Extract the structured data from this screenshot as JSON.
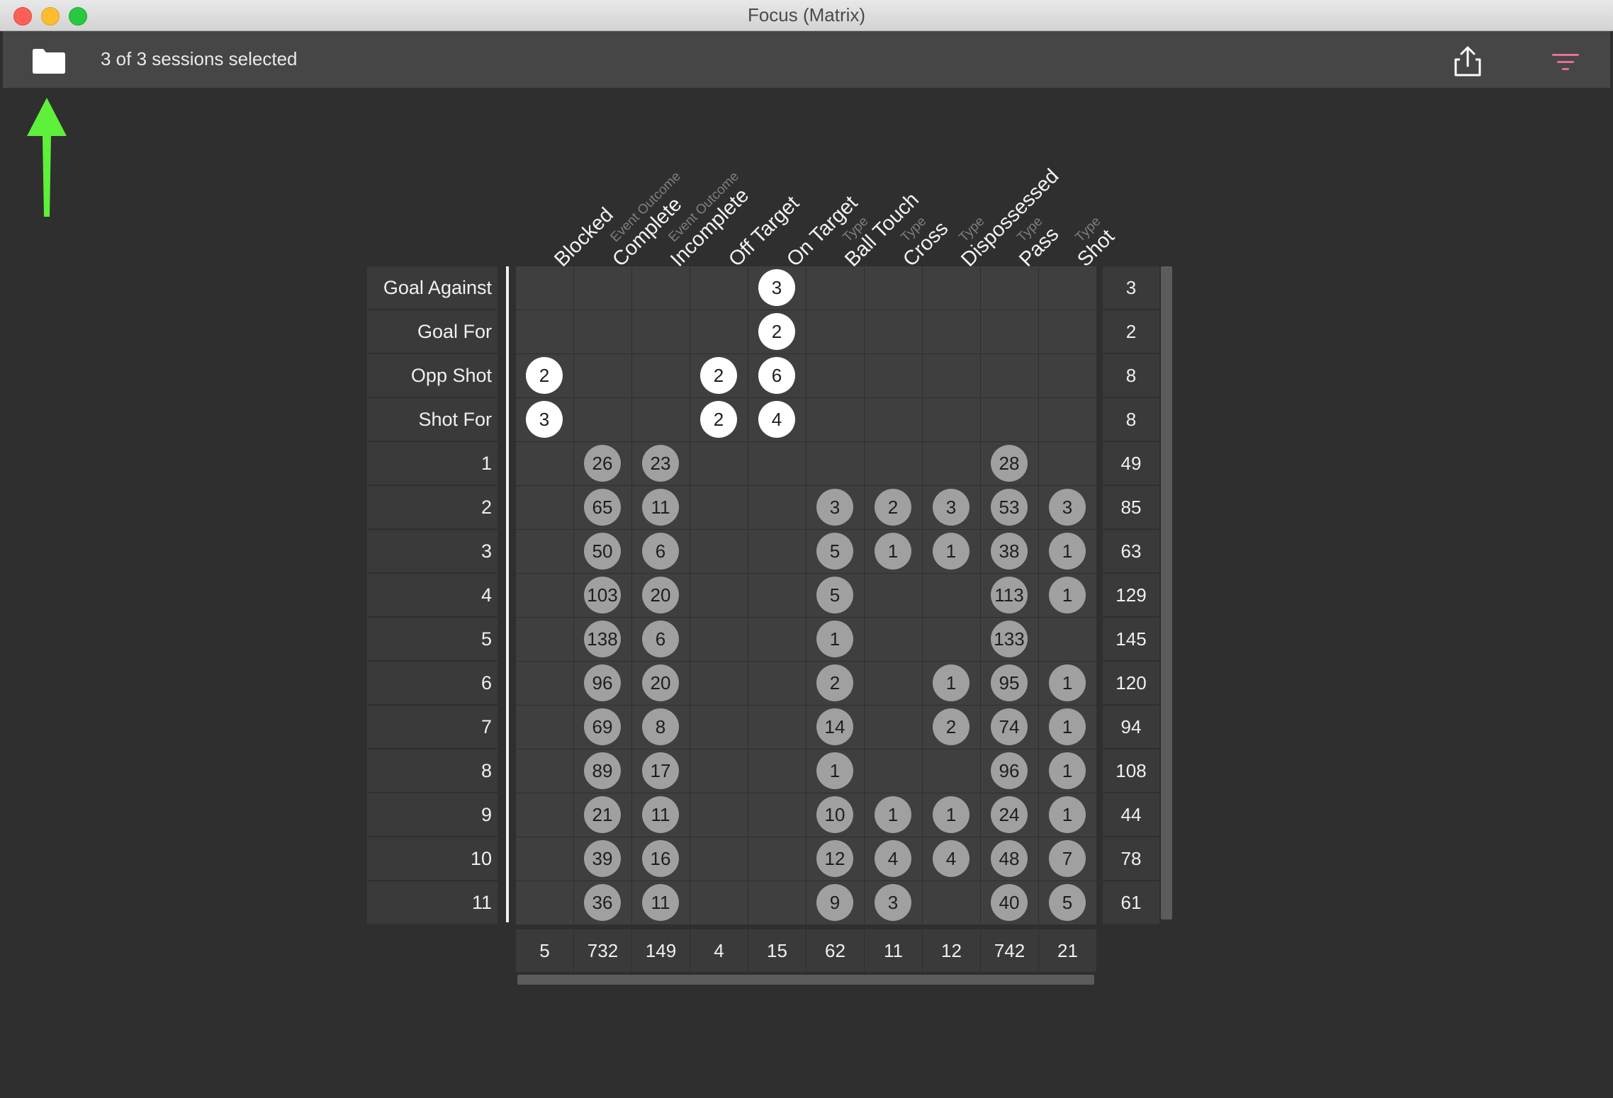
{
  "window": {
    "title": "Focus (Matrix)"
  },
  "toolbar": {
    "sessions_label": "3 of 3 sessions selected"
  },
  "columns": [
    {
      "label": "Blocked",
      "sub": ""
    },
    {
      "label": "Complete",
      "sub": "Event Outcome"
    },
    {
      "label": "Incomplete",
      "sub": "Event Outcome"
    },
    {
      "label": "Off Target",
      "sub": ""
    },
    {
      "label": "On Target",
      "sub": ""
    },
    {
      "label": "Ball Touch",
      "sub": "Type"
    },
    {
      "label": "Cross",
      "sub": "Type"
    },
    {
      "label": "Dispossessed",
      "sub": "Type"
    },
    {
      "label": "Pass",
      "sub": "Type"
    },
    {
      "label": "Shot",
      "sub": "Type"
    }
  ],
  "rows": [
    {
      "label": "Goal Against",
      "style": "white",
      "values": [
        null,
        null,
        null,
        null,
        "3",
        null,
        null,
        null,
        null,
        null
      ],
      "total": "3"
    },
    {
      "label": "Goal For",
      "style": "white",
      "values": [
        null,
        null,
        null,
        null,
        "2",
        null,
        null,
        null,
        null,
        null
      ],
      "total": "2"
    },
    {
      "label": "Opp Shot",
      "style": "white",
      "values": [
        "2",
        null,
        null,
        "2",
        "6",
        null,
        null,
        null,
        null,
        null
      ],
      "total": "8"
    },
    {
      "label": "Shot For",
      "style": "white",
      "values": [
        "3",
        null,
        null,
        "2",
        "4",
        null,
        null,
        null,
        null,
        null
      ],
      "total": "8"
    },
    {
      "label": "1",
      "style": "gray",
      "values": [
        null,
        "26",
        "23",
        null,
        null,
        null,
        null,
        null,
        "28",
        null
      ],
      "total": "49"
    },
    {
      "label": "2",
      "style": "gray",
      "values": [
        null,
        "65",
        "11",
        null,
        null,
        "3",
        "2",
        "3",
        "53",
        "3"
      ],
      "total": "85"
    },
    {
      "label": "3",
      "style": "gray",
      "values": [
        null,
        "50",
        "6",
        null,
        null,
        "5",
        "1",
        "1",
        "38",
        "1"
      ],
      "total": "63"
    },
    {
      "label": "4",
      "style": "gray",
      "values": [
        null,
        "103",
        "20",
        null,
        null,
        "5",
        null,
        null,
        "113",
        "1"
      ],
      "total": "129"
    },
    {
      "label": "5",
      "style": "gray",
      "values": [
        null,
        "138",
        "6",
        null,
        null,
        "1",
        null,
        null,
        "133",
        null
      ],
      "total": "145"
    },
    {
      "label": "6",
      "style": "gray",
      "values": [
        null,
        "96",
        "20",
        null,
        null,
        "2",
        null,
        "1",
        "95",
        "1"
      ],
      "total": "120"
    },
    {
      "label": "7",
      "style": "gray",
      "values": [
        null,
        "69",
        "8",
        null,
        null,
        "14",
        null,
        "2",
        "74",
        "1"
      ],
      "total": "94"
    },
    {
      "label": "8",
      "style": "gray",
      "values": [
        null,
        "89",
        "17",
        null,
        null,
        "1",
        null,
        null,
        "96",
        "1"
      ],
      "total": "108"
    },
    {
      "label": "9",
      "style": "gray",
      "values": [
        null,
        "21",
        "11",
        null,
        null,
        "10",
        "1",
        "1",
        "24",
        "1"
      ],
      "total": "44"
    },
    {
      "label": "10",
      "style": "gray",
      "values": [
        null,
        "39",
        "16",
        null,
        null,
        "12",
        "4",
        "4",
        "48",
        "7"
      ],
      "total": "78"
    },
    {
      "label": "11",
      "style": "gray",
      "values": [
        null,
        "36",
        "11",
        null,
        null,
        "9",
        "3",
        null,
        "40",
        "5"
      ],
      "total": "61"
    }
  ],
  "column_totals": [
    "5",
    "732",
    "149",
    "4",
    "15",
    "62",
    "11",
    "12",
    "742",
    "21"
  ],
  "colors": {
    "annotation_arrow": "#5ef03a",
    "filter_icon": "#e86d96",
    "bubble_highlight": "#ffffff",
    "bubble_default": "#a0a0a0"
  }
}
